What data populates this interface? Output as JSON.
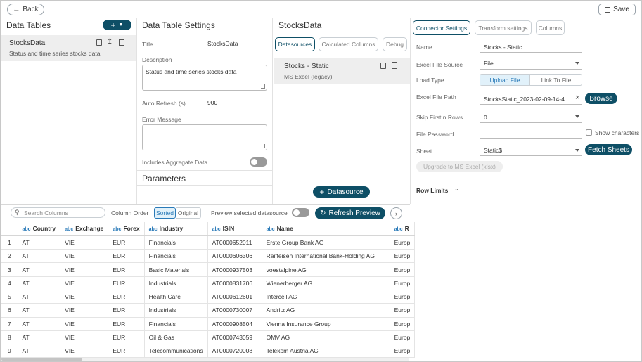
{
  "topbar": {
    "back_label": "Back",
    "save_label": "Save"
  },
  "data_tables": {
    "title": "Data Tables",
    "items": [
      {
        "name": "StocksData",
        "description": "Status and time series stocks data"
      }
    ]
  },
  "settings": {
    "title": "Data Table Settings",
    "title_label": "Title",
    "title_value": "StocksData",
    "description_label": "Description",
    "description_value": "Status and time series stocks data",
    "auto_refresh_label": "Auto Refresh (s)",
    "auto_refresh_value": "900",
    "error_label": "Error Message",
    "aggregate_label": "Includes Aggregate Data",
    "parameters_title": "Parameters"
  },
  "datasources": {
    "title": "StocksData",
    "tabs": [
      "Datasources",
      "Calculated Columns",
      "Debug"
    ],
    "items": [
      {
        "name": "Stocks - Static",
        "type": "MS Excel (legacy)"
      }
    ],
    "add_label": "Datasource"
  },
  "connector": {
    "tabs": [
      "Connector Settings",
      "Transform settings",
      "Columns"
    ],
    "name_label": "Name",
    "name_value": "Stocks - Static",
    "source_label": "Excel File Source",
    "source_value": "File",
    "load_type_label": "Load Type",
    "load_options": [
      "Upload File",
      "Link To File"
    ],
    "path_label": "Excel File Path",
    "path_value": "StocksStatic_2023-02-09-14-4...",
    "browse_label": "Browse",
    "skip_label": "Skip First n Rows",
    "skip_value": "0",
    "password_label": "File Password",
    "show_chars_label": "Show characters",
    "sheet_label": "Sheet",
    "sheet_value": "Static$",
    "fetch_label": "Fetch Sheets",
    "upgrade_label": "Upgrade to MS Excel (xlsx)",
    "row_limits_label": "Row Limits"
  },
  "preview": {
    "search_placeholder": "Search Columns",
    "column_order_label": "Column Order",
    "sorted_label": "Sorted",
    "original_label": "Original",
    "preview_label": "Preview selected datasource",
    "refresh_label": "Refresh Preview",
    "type_tag": "abc",
    "columns": [
      "Country",
      "Exchange",
      "Forex",
      "Industry",
      "ISIN",
      "Name",
      "R"
    ],
    "rows": [
      [
        "1",
        "AT",
        "VIE",
        "EUR",
        "Financials",
        "AT0000652011",
        "Erste Group Bank AG",
        "Europ"
      ],
      [
        "2",
        "AT",
        "VIE",
        "EUR",
        "Financials",
        "AT0000606306",
        "Raiffeisen International Bank-Holding AG",
        "Europ"
      ],
      [
        "3",
        "AT",
        "VIE",
        "EUR",
        "Basic Materials",
        "AT0000937503",
        "voestalpine AG",
        "Europ"
      ],
      [
        "4",
        "AT",
        "VIE",
        "EUR",
        "Industrials",
        "AT0000831706",
        "Wienerberger AG",
        "Europ"
      ],
      [
        "5",
        "AT",
        "VIE",
        "EUR",
        "Health Care",
        "AT0000612601",
        "Intercell AG",
        "Europ"
      ],
      [
        "6",
        "AT",
        "VIE",
        "EUR",
        "Industrials",
        "AT0000730007",
        "Andritz AG",
        "Europ"
      ],
      [
        "7",
        "AT",
        "VIE",
        "EUR",
        "Financials",
        "AT0000908504",
        "Vienna Insurance Group",
        "Europ"
      ],
      [
        "8",
        "AT",
        "VIE",
        "EUR",
        "Oil & Gas",
        "AT0000743059",
        "OMV AG",
        "Europ"
      ],
      [
        "9",
        "AT",
        "VIE",
        "EUR",
        "Telecommunications",
        "AT0000720008",
        "Telekom Austria AG",
        "Europ"
      ]
    ]
  },
  "colors": {
    "accent": "#0e4f66",
    "link": "#2a7ab8"
  }
}
